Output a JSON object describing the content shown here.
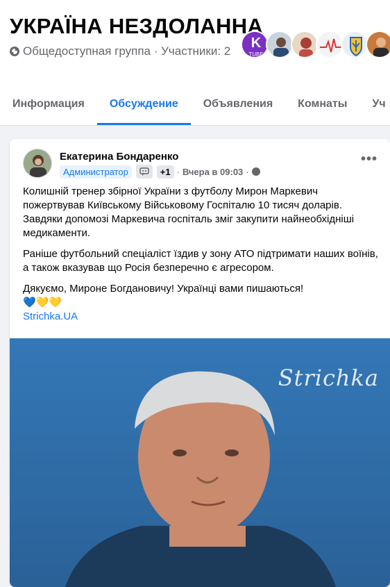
{
  "group": {
    "title": "УКРАЇНА НЕЗДОЛАННА",
    "meta": "Общедоступная группа · Участники: 2"
  },
  "members": [
    {
      "label": "TUBE",
      "color": "#8e3bd6"
    },
    {
      "label": "",
      "color": "#5a6f86"
    },
    {
      "label": "",
      "color": "#c4524a"
    },
    {
      "label": "",
      "color": "#e9ecef"
    },
    {
      "label": "",
      "color": "#f2c230"
    },
    {
      "label": "",
      "color": "#b6622a"
    }
  ],
  "tabs": [
    {
      "label": "Информация",
      "active": false
    },
    {
      "label": "Обсуждение",
      "active": true
    },
    {
      "label": "Объявления",
      "active": false
    },
    {
      "label": "Комнаты",
      "active": false
    },
    {
      "label": "Уч",
      "active": false
    }
  ],
  "post": {
    "author": "Екатерина Бондаренко",
    "role_badge": "Администратор",
    "plus_badge": "+1",
    "time": "Вчера в 09:03",
    "sep": "·",
    "more_label": "•••",
    "paragraphs": [
      "Колишній тренер збірної України з футболу Мирон Маркевич пожертвував Київському Військовому Госпіталю 10 тисяч доларів. Завдяки допомозі Маркевича госпіталь зміг закупити найнеобхідніші медикаменти.",
      "Раніше футбольний спеціаліст їздив у зону АТО підтримати наших воїнів, а також вказував що Росія безперечно є агресором.",
      "Дякуємо, Мироне Богдановичу! Українці вами пишаються!"
    ],
    "emoji": "💙💛💛",
    "link": "Strichka.UA",
    "photo_watermark": "Strichka"
  }
}
